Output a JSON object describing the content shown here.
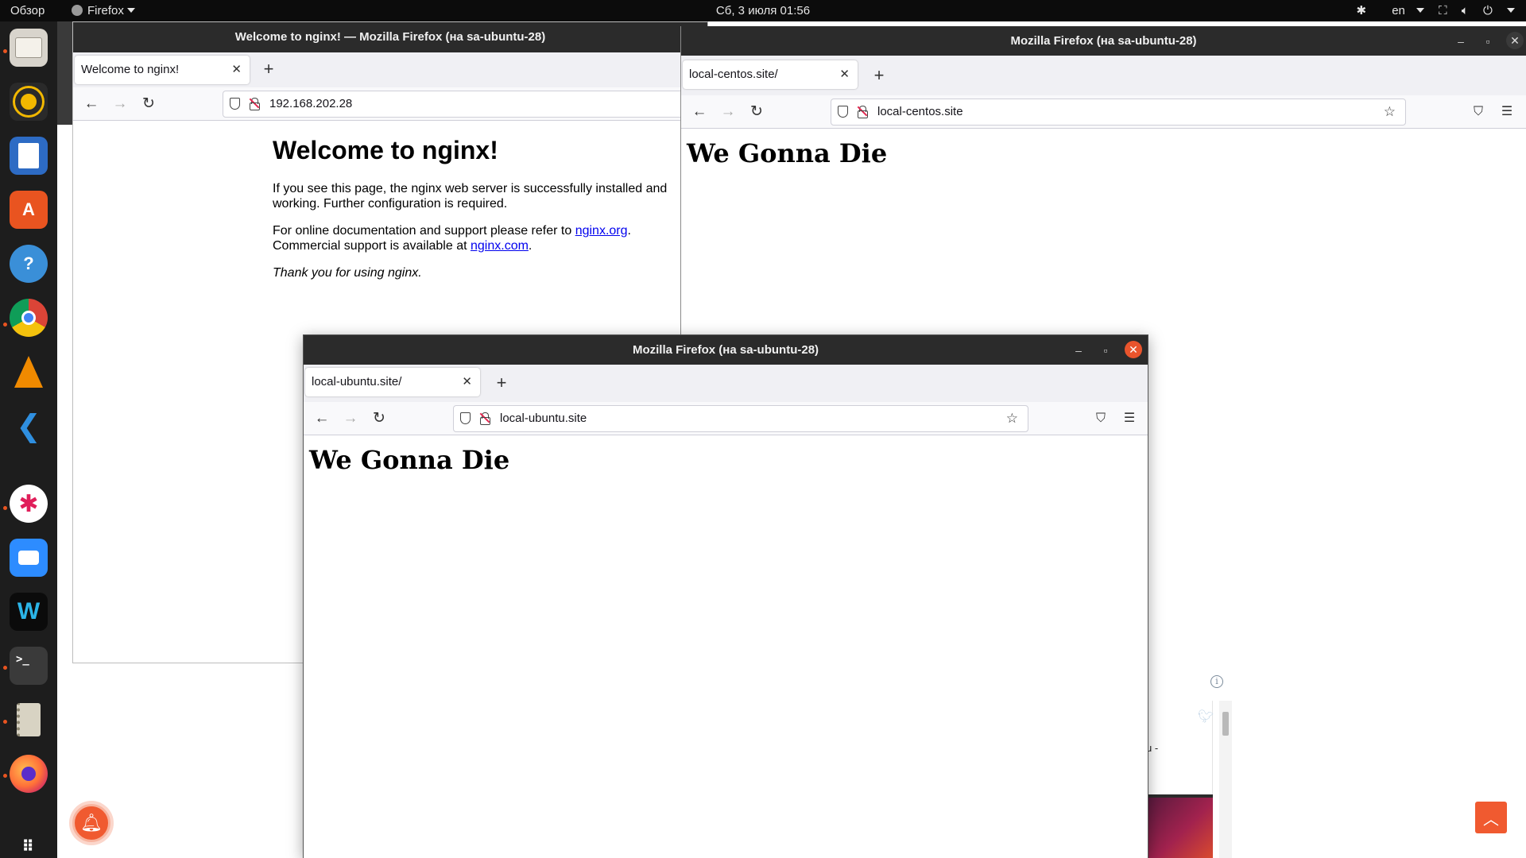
{
  "topbar": {
    "overview": "Обзор",
    "app_name": "Firefox",
    "clock": "Сб, 3 июля  01:56",
    "lang": "en"
  },
  "dock": {
    "items": [
      "files",
      "rhythmbox",
      "writer",
      "software",
      "help",
      "chrome",
      "vlc",
      "vscode",
      "slack",
      "zoom",
      "webex",
      "terminal",
      "archive",
      "firefox",
      "show-apps"
    ]
  },
  "windows": {
    "nginx": {
      "title": "Welcome to nginx! — Mozilla Firefox (на sa-ubuntu-28)",
      "tab": "Welcome to nginx!",
      "url": "192.168.202.28",
      "page": {
        "heading": "Welcome to nginx!",
        "p1": "If you see this page, the nginx web server is successfully installed and working. Further configuration is required.",
        "p2_a": "For online documentation and support please refer to ",
        "link1": "nginx.org",
        "p2_b": ".",
        "p2_c": "Commercial support is available at ",
        "link2": "nginx.com",
        "p2_d": ".",
        "thanks": "Thank you for using nginx."
      }
    },
    "centos": {
      "title": "Mozilla Firefox (на sa-ubuntu-28)",
      "tab": "local-centos.site/",
      "url": "local-centos.site",
      "heading": "We Gonna Die"
    },
    "ubuntu": {
      "title": "Mozilla Firefox (на sa-ubuntu-28)",
      "tab": "local-ubuntu.site/",
      "url": "local-ubuntu.site",
      "heading": "We Gonna Die"
    }
  },
  "background": {
    "snippet": "u -"
  },
  "colors": {
    "accent": "#e95420",
    "link": "#0000ee",
    "close": "#e9542c"
  }
}
